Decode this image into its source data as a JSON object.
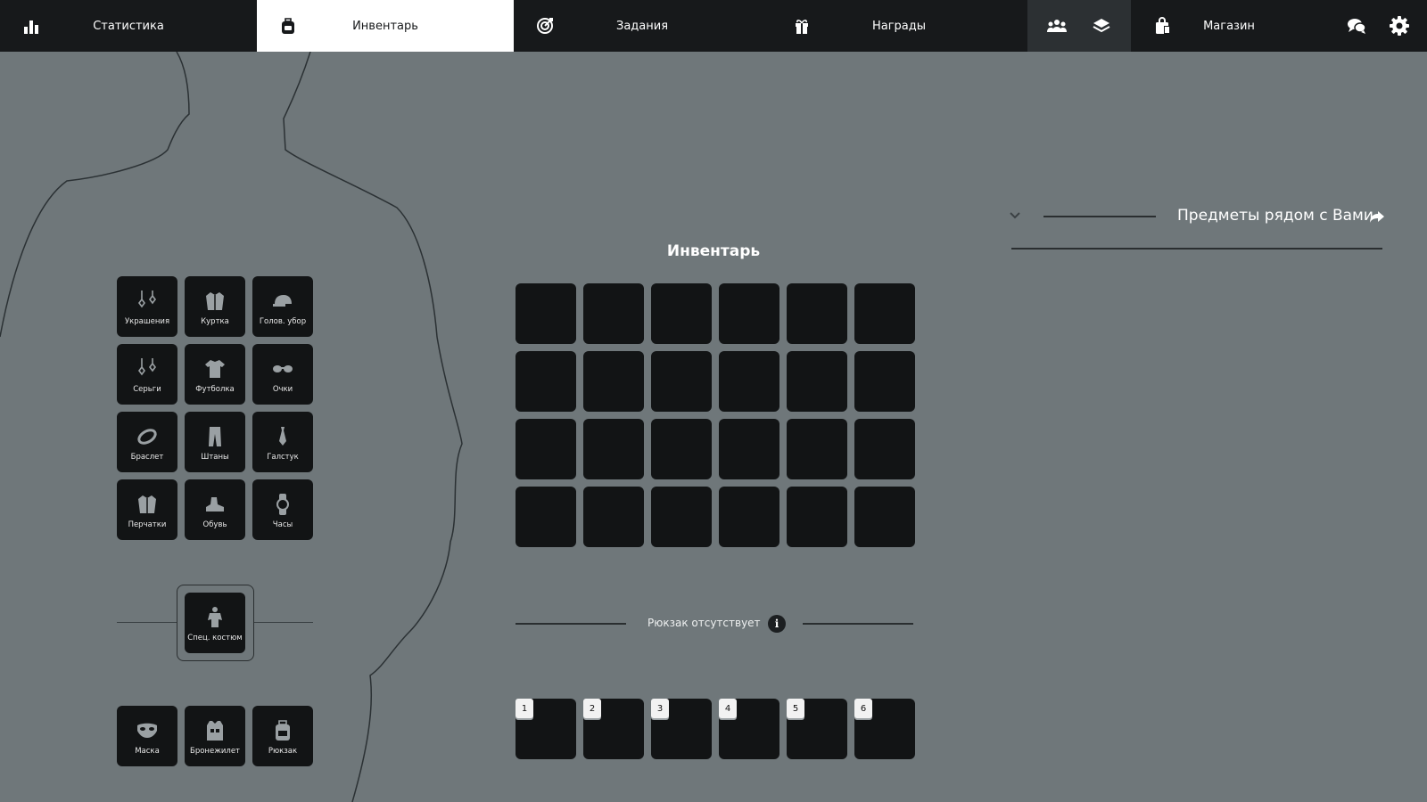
{
  "nav": {
    "tabs": [
      {
        "label": "Статистика",
        "icon": "bar-chart-icon",
        "active": false
      },
      {
        "label": "Инвентарь",
        "icon": "backpack-icon",
        "active": true
      },
      {
        "label": "Задания",
        "icon": "target-icon",
        "active": false
      },
      {
        "label": "Награды",
        "icon": "gift-icon",
        "active": false
      }
    ],
    "group_icons": [
      "group-icon",
      "layers-icon"
    ],
    "shop": {
      "label": "Магазин",
      "icon": "shopping-bag-icon"
    },
    "right_icons": [
      "chat-icon",
      "gear-icon"
    ]
  },
  "equipment": {
    "slots": [
      {
        "label": "Украшения",
        "icon": "jewelry-icon"
      },
      {
        "label": "Куртка",
        "icon": "jacket-icon"
      },
      {
        "label": "Голов. убор",
        "icon": "cap-icon"
      },
      {
        "label": "Серьги",
        "icon": "earrings-icon"
      },
      {
        "label": "Футболка",
        "icon": "tshirt-icon"
      },
      {
        "label": "Очки",
        "icon": "glasses-icon"
      },
      {
        "label": "Браслет",
        "icon": "bracelet-icon"
      },
      {
        "label": "Штаны",
        "icon": "pants-icon"
      },
      {
        "label": "Галстук",
        "icon": "tie-icon"
      },
      {
        "label": "Перчатки",
        "icon": "gloves-icon"
      },
      {
        "label": "Обувь",
        "icon": "shoes-icon"
      },
      {
        "label": "Часы",
        "icon": "watch-icon"
      }
    ],
    "special": {
      "label": "Спец. костюм",
      "icon": "suit-icon"
    },
    "bottom": [
      {
        "label": "Маска",
        "icon": "mask-icon"
      },
      {
        "label": "Бронежилет",
        "icon": "vest-icon"
      },
      {
        "label": "Рюкзак",
        "icon": "backpack-icon"
      }
    ]
  },
  "inventory": {
    "title": "Инвентарь",
    "rows": 4,
    "columns": 6,
    "backpack_status": "Рюкзак отсутствует",
    "info_label": "i",
    "quick_slots": [
      "1",
      "2",
      "3",
      "4",
      "5",
      "6"
    ]
  },
  "nearby": {
    "title": "Предметы рядом с Вами",
    "icons": [
      "chevron-down-icon",
      "share-arrow-icon"
    ]
  },
  "colors": {
    "background": "#6f777a",
    "topbar": "#17191b",
    "slot": "#121415",
    "active_tab": "#ffffff"
  }
}
